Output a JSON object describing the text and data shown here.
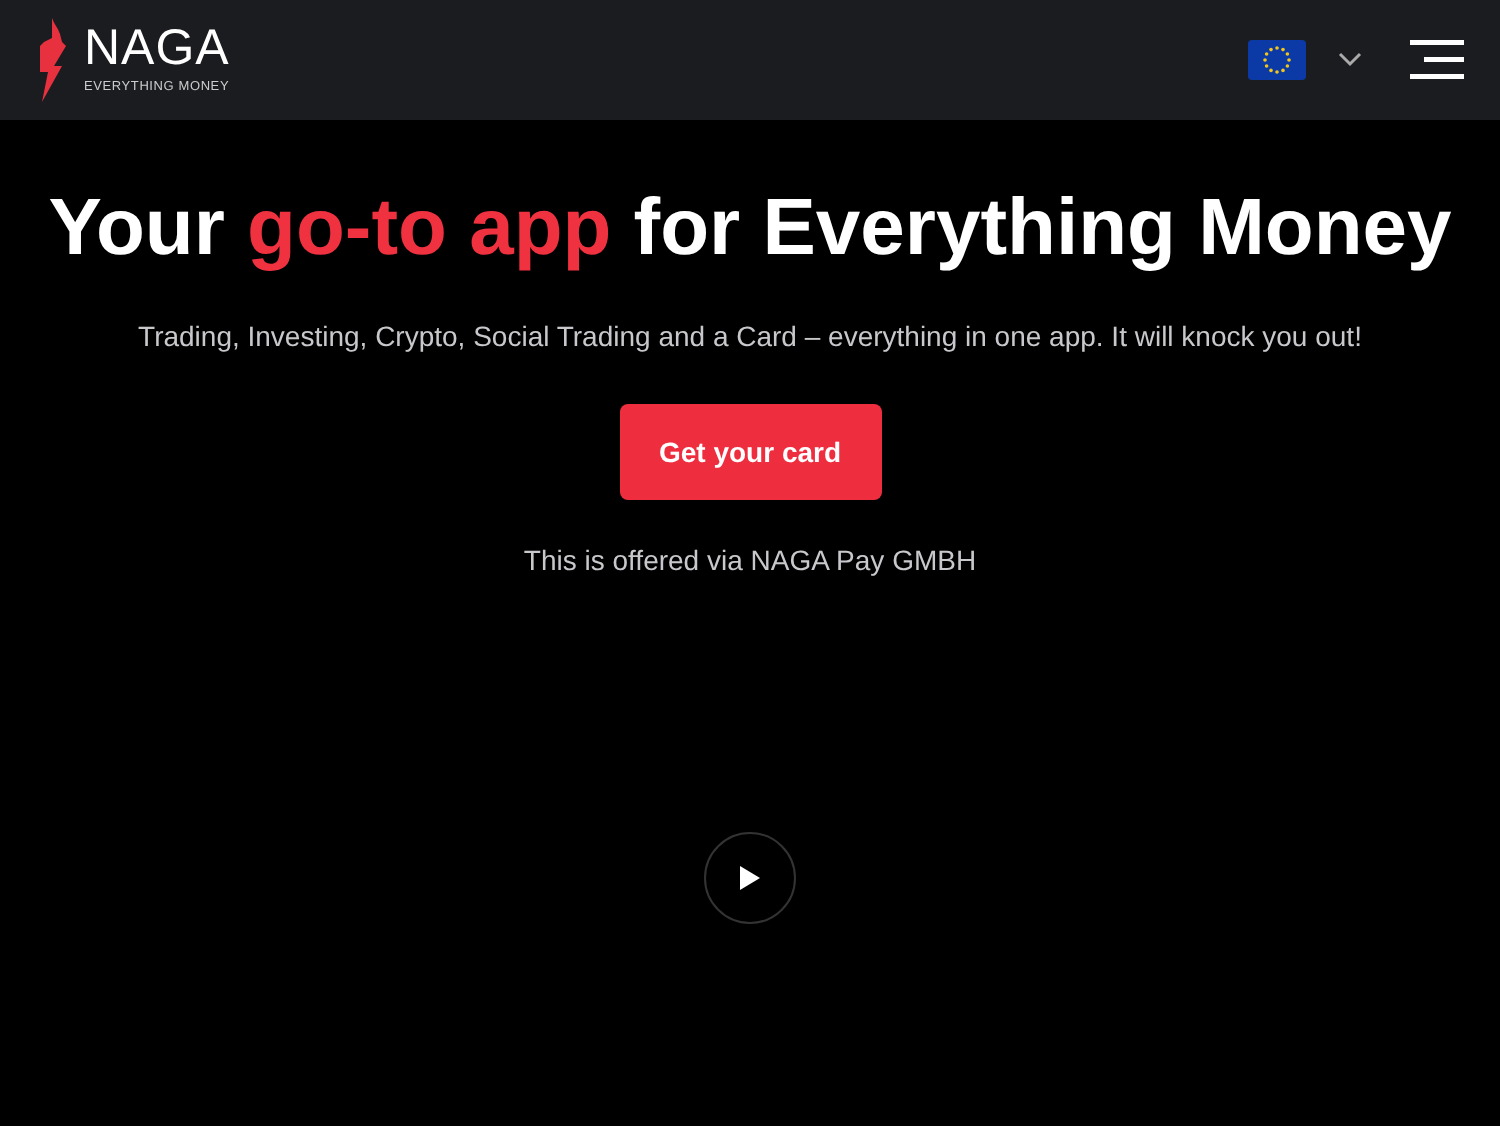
{
  "header": {
    "logo": {
      "name": "NAGA",
      "tagline": "EVERYTHING MONEY"
    }
  },
  "hero": {
    "headline": [
      {
        "text": "Your ",
        "highlight": false
      },
      {
        "text": "go-to app",
        "highlight": true
      },
      {
        "text": " for Everything Money",
        "highlight": false
      }
    ],
    "subtitle": "Trading, Investing, Crypto, Social Trading and a Card – everything in one app. It will knock you out!",
    "button": "Get your card",
    "note": "This is offered via NAGA Pay GMBH"
  }
}
